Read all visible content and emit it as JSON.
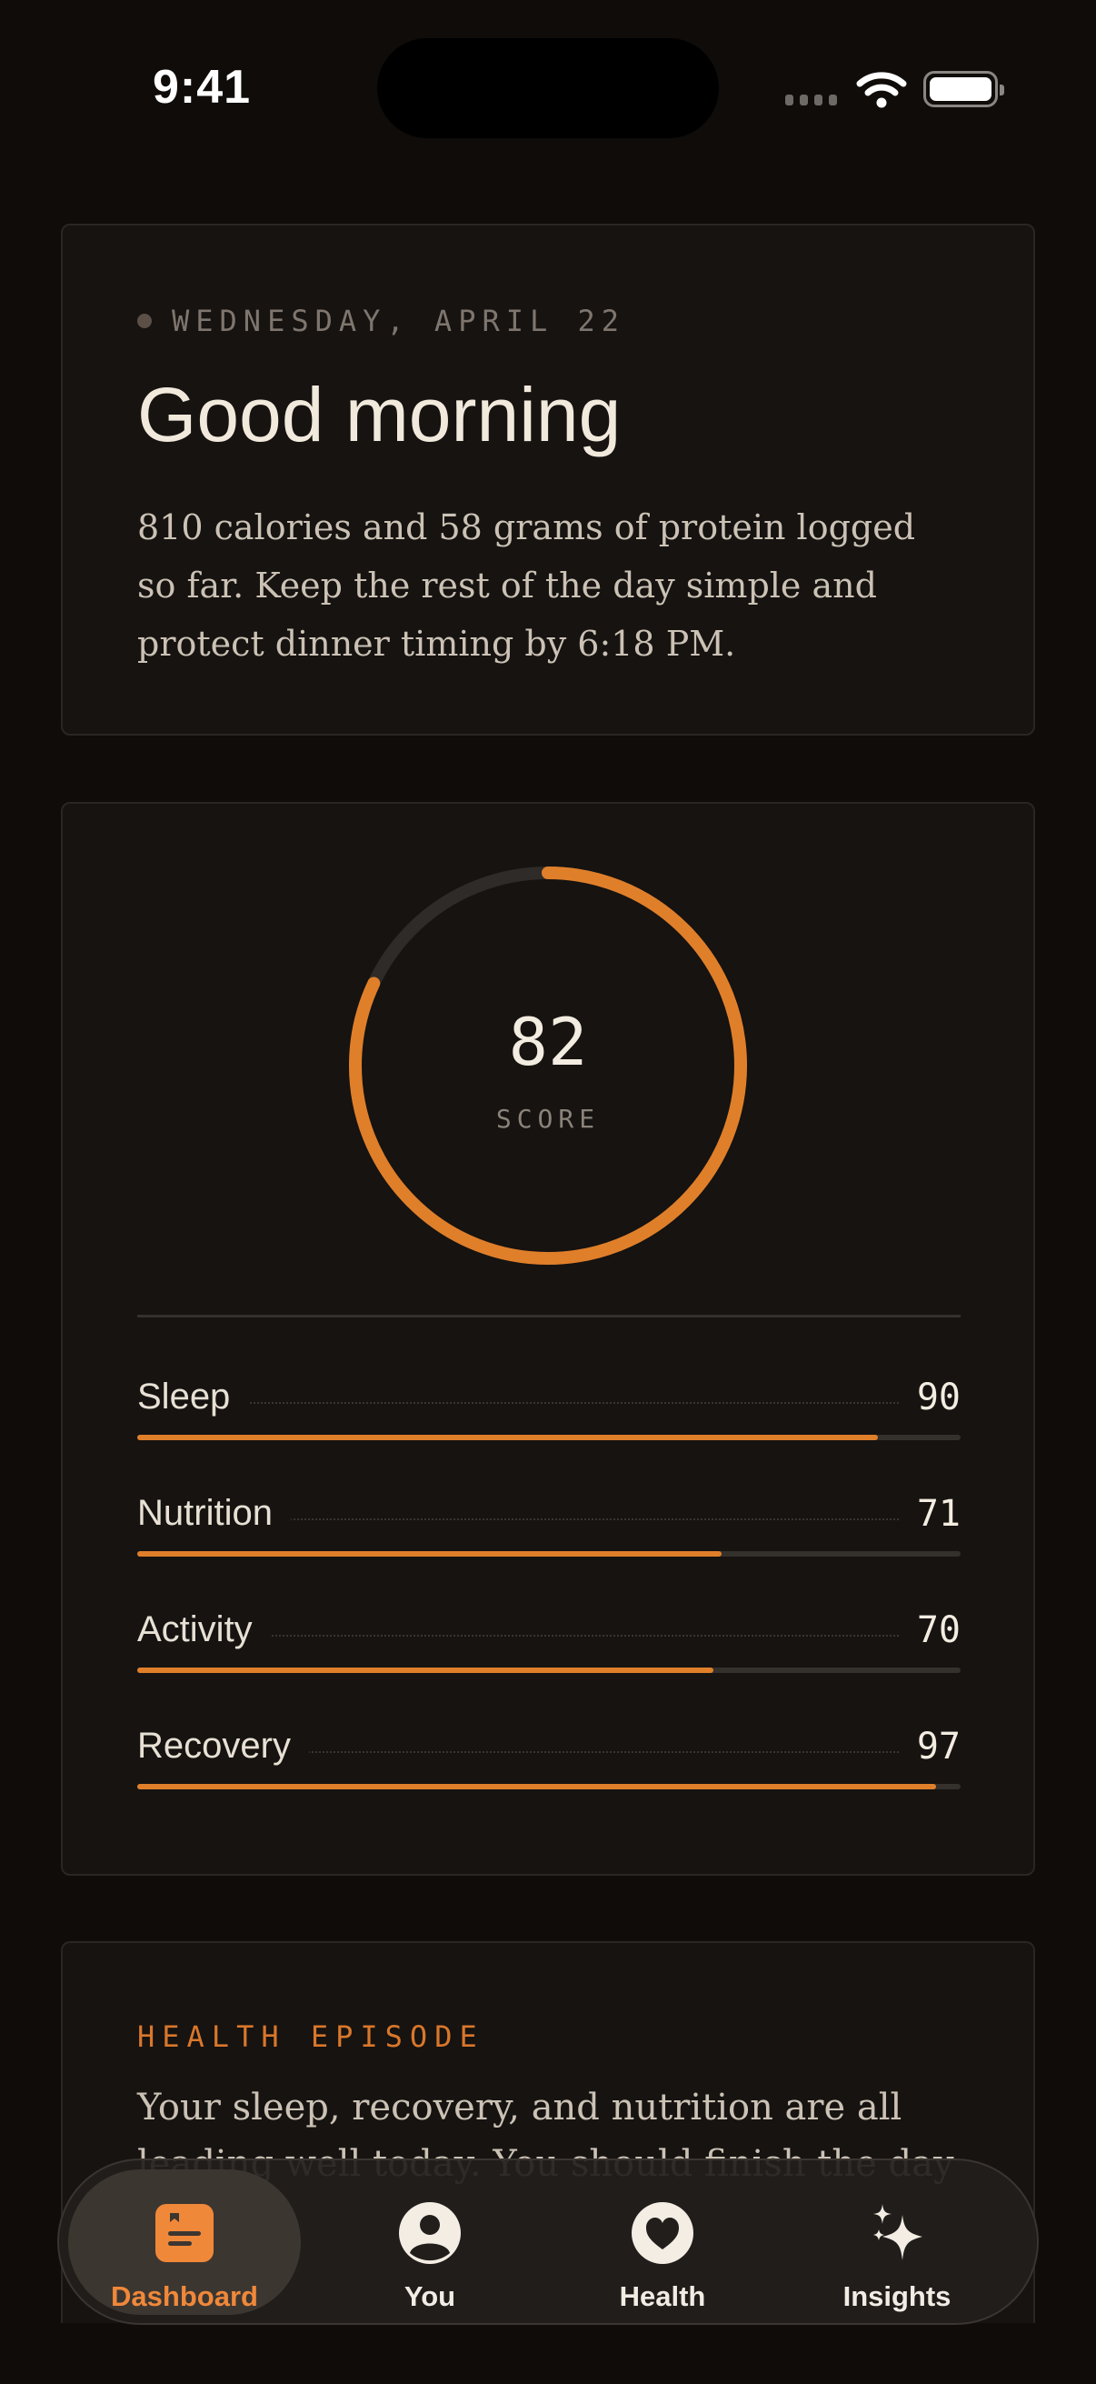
{
  "status_bar": {
    "time": "9:41"
  },
  "greeting": {
    "date": "WEDNESDAY, APRIL 22",
    "title": "Good morning",
    "body": "810 calories and 58 grams of protein logged so far. Keep the rest of the day simple and protect dinner timing by 6:18 PM."
  },
  "score_card": {
    "score": "82",
    "score_label": "SCORE",
    "score_fraction": 0.82,
    "metrics": [
      {
        "label": "Sleep",
        "value": "90",
        "fraction": 0.9
      },
      {
        "label": "Nutrition",
        "value": "71",
        "fraction": 0.71
      },
      {
        "label": "Activity",
        "value": "70",
        "fraction": 0.7
      },
      {
        "label": "Recovery",
        "value": "97",
        "fraction": 0.97
      }
    ]
  },
  "episode": {
    "title": "HEALTH EPISODE",
    "body": "Your sleep, recovery, and nutrition are all leading well today. You should finish the day strong."
  },
  "tabs": [
    {
      "label": "Dashboard",
      "icon": "dashboard-icon",
      "active": true
    },
    {
      "label": "You",
      "icon": "person-icon",
      "active": false
    },
    {
      "label": "Health",
      "icon": "heart-icon",
      "active": false
    },
    {
      "label": "Insights",
      "icon": "sparkles-icon",
      "active": false
    }
  ],
  "colors": {
    "accent": "#e07f2a",
    "background": "#0f0c0a",
    "card": "#161311"
  }
}
